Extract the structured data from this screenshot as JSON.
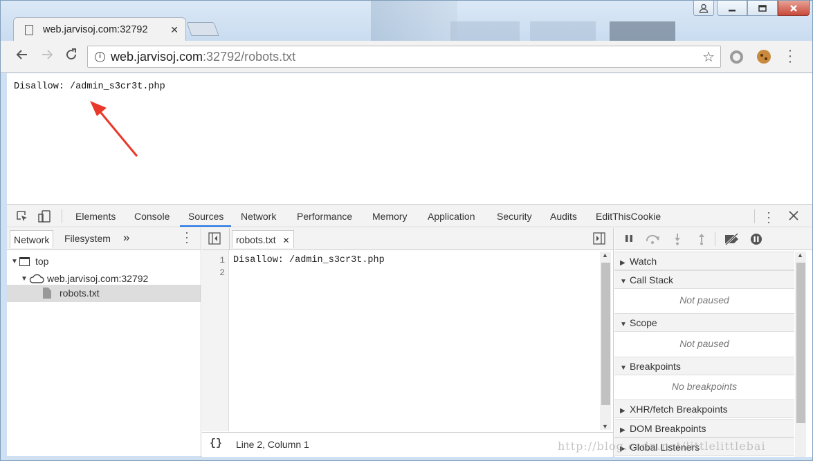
{
  "browser": {
    "tab_title": "web.jarvisoj.com:32792",
    "tab_close": "✕",
    "url_host": "web.jarvisoj.com",
    "url_rest": ":32792/robots.txt"
  },
  "page": {
    "content": "Disallow: /admin_s3cr3t.php"
  },
  "devtools": {
    "tabs": [
      {
        "label": "Elements"
      },
      {
        "label": "Console"
      },
      {
        "label": "Sources"
      },
      {
        "label": "Network"
      },
      {
        "label": "Performance"
      },
      {
        "label": "Memory"
      },
      {
        "label": "Application"
      },
      {
        "label": "Security"
      },
      {
        "label": "Audits"
      },
      {
        "label": "EditThisCookie"
      }
    ],
    "active_tab": "Sources",
    "navigator": {
      "tabs": [
        "Network",
        "Filesystem"
      ],
      "more": "»",
      "tree": [
        "top",
        "web.jarvisoj.com:32792",
        "robots.txt"
      ]
    },
    "editor": {
      "file_tab": "robots.txt",
      "file_tab_close": "✕",
      "lines": [
        {
          "no": "1",
          "text": "Disallow: /admin_s3cr3t.php"
        },
        {
          "no": "2",
          "text": ""
        }
      ],
      "format_button": "{}",
      "status": "Line 2, Column 1"
    },
    "debugger": {
      "sections": [
        {
          "label": "Watch"
        },
        {
          "label": "Call Stack",
          "message": "Not paused"
        },
        {
          "label": "Scope",
          "message": "Not paused"
        },
        {
          "label": "Breakpoints",
          "message": "No breakpoints"
        },
        {
          "label": "XHR/fetch Breakpoints"
        },
        {
          "label": "DOM Breakpoints"
        },
        {
          "label": "Global Listeners"
        }
      ]
    }
  },
  "watermark": "http://blog.csdn.net/littlelittlebai",
  "colors": {
    "accent": "#1a73e8",
    "arrow": "#e8392b"
  }
}
